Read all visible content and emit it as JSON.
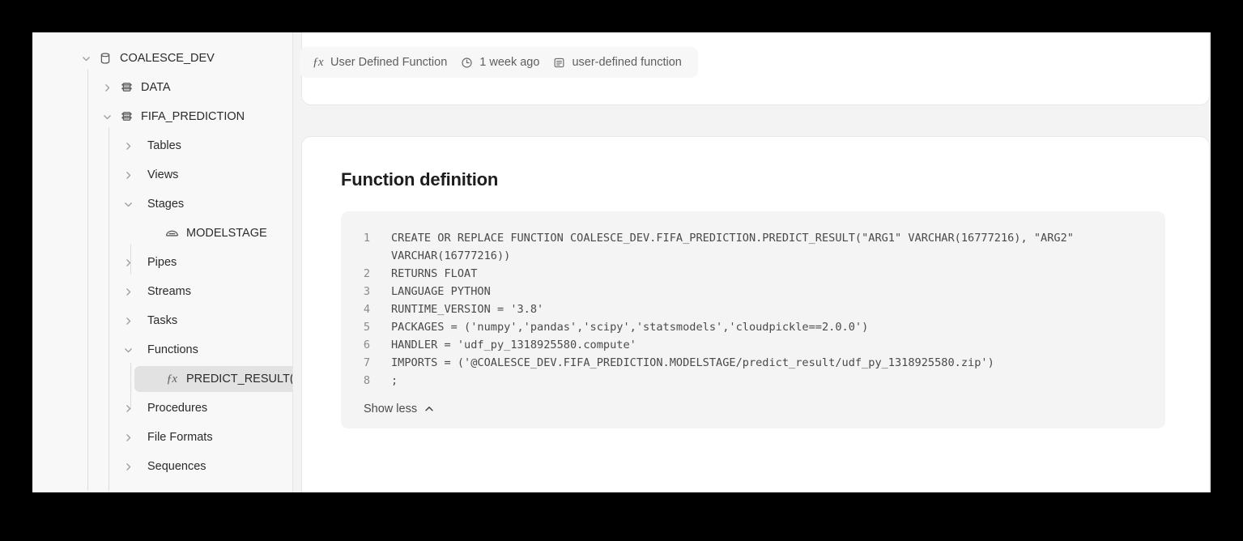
{
  "sidebar": {
    "items": [
      {
        "label": "COALESCE_DEV",
        "icon": "database-icon",
        "depth": 0,
        "expanded": true,
        "has_toggle": true,
        "selected": false
      },
      {
        "label": "DATA",
        "icon": "schema-icon",
        "depth": 1,
        "expanded": false,
        "has_toggle": true,
        "selected": false
      },
      {
        "label": "FIFA_PREDICTION",
        "icon": "schema-icon",
        "depth": 1,
        "expanded": true,
        "has_toggle": true,
        "selected": false
      },
      {
        "label": "Tables",
        "icon": "none",
        "depth": 2,
        "expanded": false,
        "has_toggle": true,
        "selected": false
      },
      {
        "label": "Views",
        "icon": "none",
        "depth": 2,
        "expanded": false,
        "has_toggle": true,
        "selected": false
      },
      {
        "label": "Stages",
        "icon": "none",
        "depth": 2,
        "expanded": true,
        "has_toggle": true,
        "selected": false
      },
      {
        "label": "MODELSTAGE",
        "icon": "stage-icon",
        "depth": 3,
        "expanded": false,
        "has_toggle": false,
        "selected": false
      },
      {
        "label": "Pipes",
        "icon": "none",
        "depth": 2,
        "expanded": false,
        "has_toggle": true,
        "selected": false
      },
      {
        "label": "Streams",
        "icon": "none",
        "depth": 2,
        "expanded": false,
        "has_toggle": true,
        "selected": false
      },
      {
        "label": "Tasks",
        "icon": "none",
        "depth": 2,
        "expanded": false,
        "has_toggle": true,
        "selected": false
      },
      {
        "label": "Functions",
        "icon": "none",
        "depth": 2,
        "expanded": true,
        "has_toggle": true,
        "selected": false
      },
      {
        "label": "PREDICT_RESULT(V...",
        "icon": "function-icon",
        "depth": 3,
        "expanded": false,
        "has_toggle": false,
        "selected": true
      },
      {
        "label": "Procedures",
        "icon": "none",
        "depth": 2,
        "expanded": false,
        "has_toggle": true,
        "selected": false
      },
      {
        "label": "File Formats",
        "icon": "none",
        "depth": 2,
        "expanded": false,
        "has_toggle": true,
        "selected": false
      },
      {
        "label": "Sequences",
        "icon": "none",
        "depth": 2,
        "expanded": false,
        "has_toggle": true,
        "selected": false
      }
    ],
    "selected_background": "#e2e2e2",
    "background": "#f8f8f8"
  },
  "meta_bar": {
    "items": [
      {
        "label": "User Defined Function",
        "icon": "function-icon"
      },
      {
        "label": "1 week ago",
        "icon": "clock-icon"
      },
      {
        "label": "user-defined function",
        "icon": "document-icon"
      }
    ]
  },
  "main": {
    "section_title": "Function definition",
    "code": {
      "lines": [
        {
          "number": "1",
          "text": "CREATE OR REPLACE FUNCTION COALESCE_DEV.FIFA_PREDICTION.PREDICT_RESULT(\"ARG1\" VARCHAR(16777216), \"ARG2\" VARCHAR(16777216))"
        },
        {
          "number": "2",
          "text": "RETURNS FLOAT"
        },
        {
          "number": "3",
          "text": "LANGUAGE PYTHON"
        },
        {
          "number": "4",
          "text": "RUNTIME_VERSION = '3.8'"
        },
        {
          "number": "5",
          "text": "PACKAGES = ('numpy','pandas','scipy','statsmodels','cloudpickle==2.0.0')"
        },
        {
          "number": "6",
          "text": "HANDLER = 'udf_py_1318925580.compute'"
        },
        {
          "number": "7",
          "text": "IMPORTS = ('@COALESCE_DEV.FIFA_PREDICTION.MODELSTAGE/predict_result/udf_py_1318925580.zip')"
        },
        {
          "number": "8",
          "text": ";"
        }
      ],
      "background": "#f4f4f4"
    },
    "show_less_label": "Show less"
  }
}
